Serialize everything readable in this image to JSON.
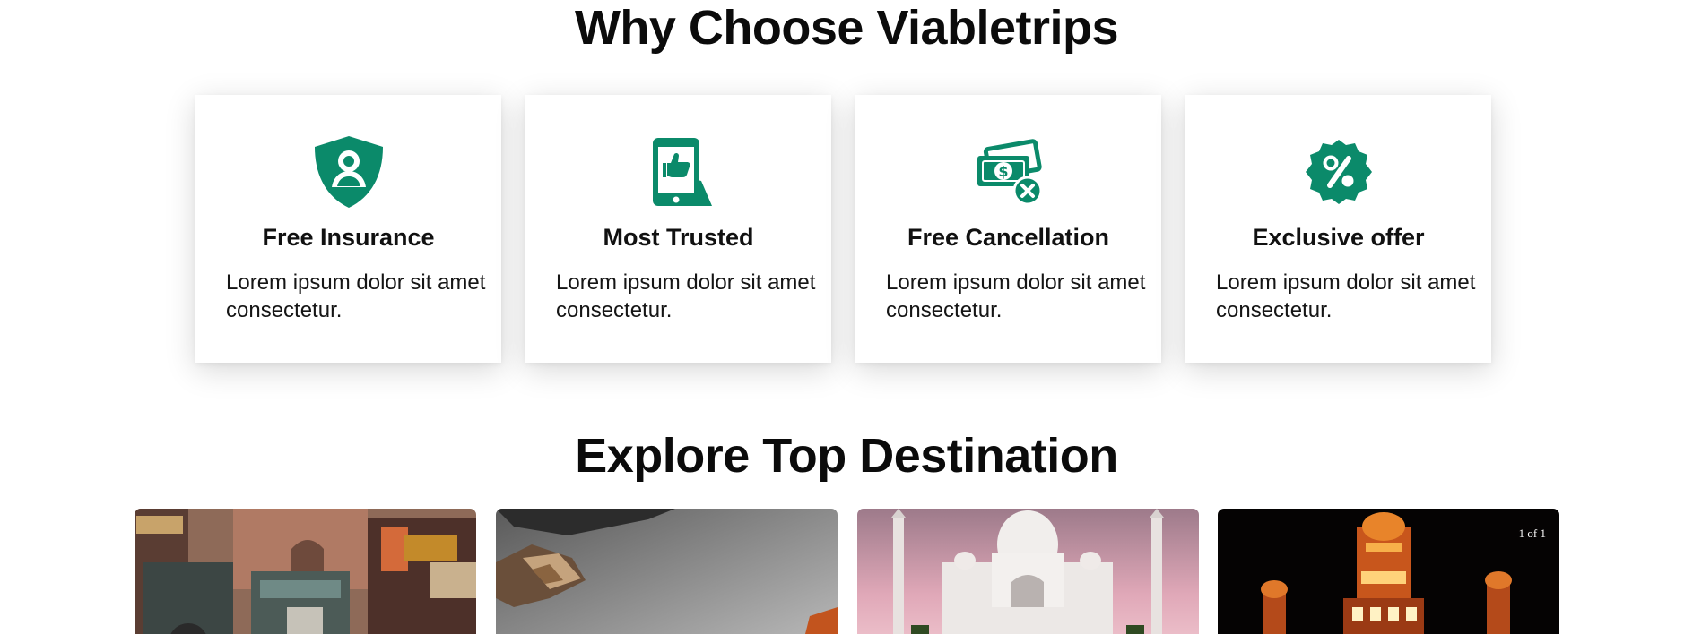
{
  "why": {
    "title": "Why Choose Viabletrips",
    "features": [
      {
        "icon": "shield-user-icon",
        "title": "Free Insurance",
        "desc": "Lorem ipsum dolor sit amet consectetur."
      },
      {
        "icon": "phone-thumbs-up-icon",
        "title": "Most Trusted",
        "desc": "Lorem ipsum dolor sit amet consectetur."
      },
      {
        "icon": "money-cancel-icon",
        "title": "Free Cancellation",
        "desc": "Lorem ipsum dolor sit amet consectetur."
      },
      {
        "icon": "discount-badge-icon",
        "title": "Exclusive offer",
        "desc": "Lorem ipsum dolor sit amet consectetur."
      }
    ],
    "accent_color": "#0b8a6a"
  },
  "explore": {
    "title": "Explore Top Destination",
    "pager": "1 of 1"
  }
}
